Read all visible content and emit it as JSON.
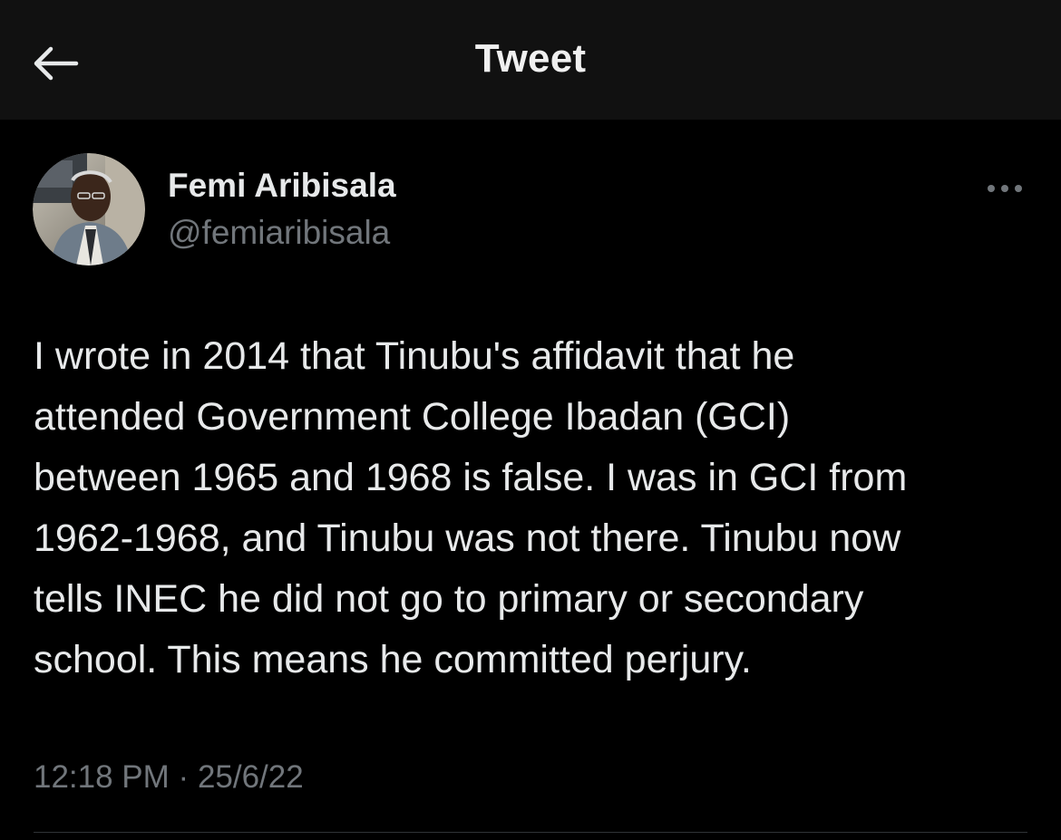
{
  "header": {
    "title": "Tweet",
    "back_icon": "arrow-left-icon"
  },
  "tweet": {
    "author": {
      "display_name": "Femi Aribisala",
      "handle": "@femiaribisala",
      "avatar": "avatar-photo"
    },
    "more_icon": "more-horizontal-icon",
    "text": "I wrote in 2014 that Tinubu's affidavit that he\nattended Government College Ibadan (GCI)\nbetween 1965 and 1968 is false. I was in GCI from\n1962-1968, and Tinubu was not there. Tinubu now\ntells INEC he did not go to primary or secondary\nschool. This means he committed perjury.",
    "time": "12:18 PM",
    "separator": "·",
    "date": "25/6/22"
  },
  "colors": {
    "background": "#000000",
    "header_background": "#111111",
    "text_primary": "#e7e9ea",
    "text_secondary": "#71767b",
    "divider": "#2f3336"
  }
}
